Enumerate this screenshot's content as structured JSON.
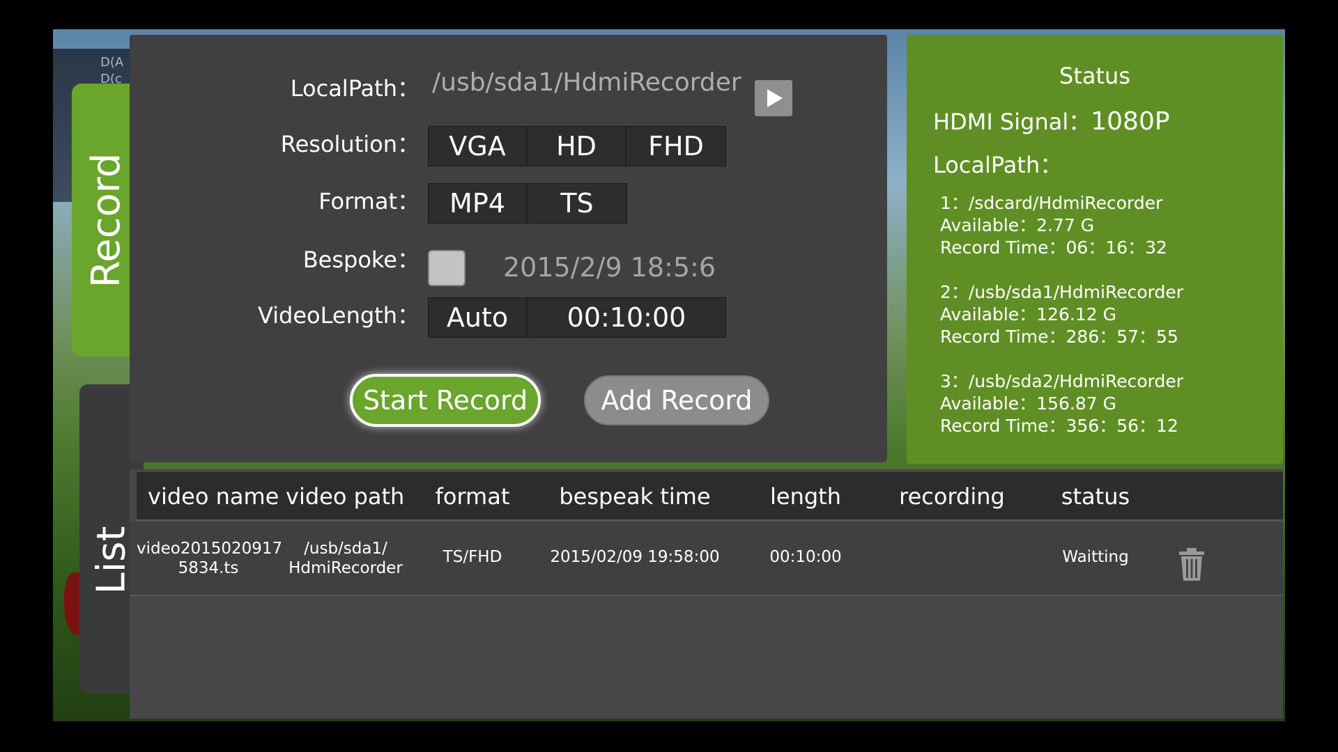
{
  "background": {
    "wall_text": "D(A\nD(c"
  },
  "tabs": {
    "record": "Record",
    "list": "List"
  },
  "settings": {
    "localpath_label": "LocalPath：",
    "localpath_value": "/usb/sda1/HdmiRecorder",
    "resolution_label": "Resolution：",
    "resolution_options": [
      "VGA",
      "HD",
      "FHD"
    ],
    "format_label": "Format：",
    "format_options": [
      "MP4",
      "TS"
    ],
    "bespoke_label": "Bespoke：",
    "bespoke_time": "2015/2/9 18:5:6",
    "videolength_label": "VideoLength：",
    "videolength_auto": "Auto",
    "videolength_value": "00:10:00",
    "start_label": "Start Record",
    "add_label": "Add Record"
  },
  "status": {
    "title": "Status",
    "hdmi_label": "HDMI Signal：",
    "hdmi_value": "1080P",
    "localpath_label": "LocalPath：",
    "storages": [
      {
        "path": "1：/sdcard/HdmiRecorder",
        "available": "Available：2.77 G",
        "record_time": "Record Time：06：16：32"
      },
      {
        "path": "2：/usb/sda1/HdmiRecorder",
        "available": "Available：126.12 G",
        "record_time": "Record Time：286：57：55"
      },
      {
        "path": "3：/usb/sda2/HdmiRecorder",
        "available": "Available：156.87 G",
        "record_time": "Record Time：356：56：12"
      }
    ]
  },
  "list": {
    "columns": [
      "video name",
      "video path",
      "format",
      "bespeak time",
      "length",
      "recording",
      "status"
    ],
    "rows": [
      {
        "name_line1": "video2015020917",
        "name_line2": "5834.ts",
        "path_line1": "/usb/sda1/",
        "path_line2": "HdmiRecorder",
        "format": "TS/FHD",
        "bespeak_time": "2015/02/09 19:58:00",
        "length": "00:10:00",
        "recording": "",
        "status": "Waitting"
      }
    ]
  },
  "colors": {
    "accent_green": "#6aa52c",
    "status_green": "#5f8f24",
    "panel_dark": "#404040"
  },
  "icons": {
    "play": "play-icon",
    "delete": "trash-icon"
  }
}
